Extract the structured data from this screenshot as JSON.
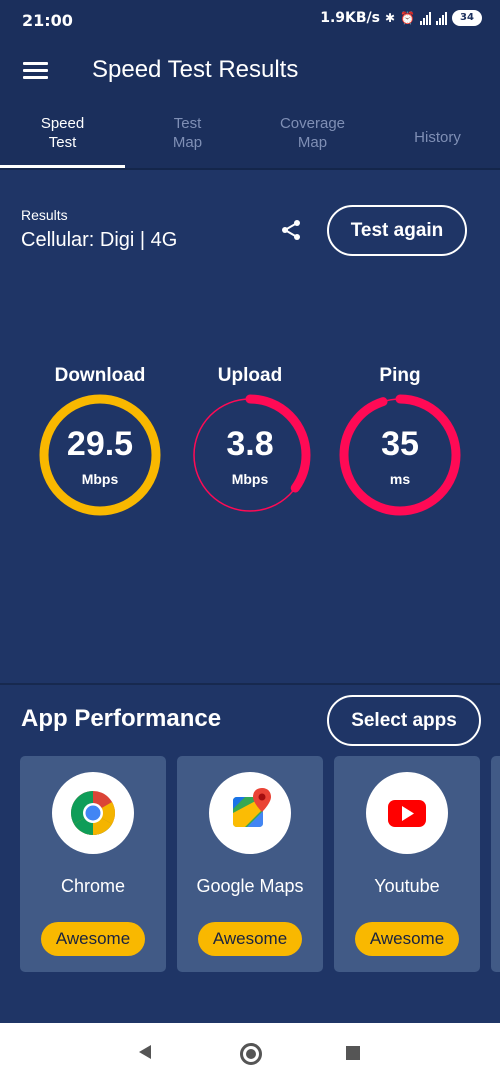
{
  "status_bar": {
    "time": "21:00",
    "net_speed": "1.9KB/s",
    "battery": "34"
  },
  "app_bar": {
    "title": "Speed Test Results"
  },
  "tabs": [
    {
      "label_line1": "Speed",
      "label_line2": "Test"
    },
    {
      "label_line1": "Test",
      "label_line2": "Map"
    },
    {
      "label_line1": "Coverage",
      "label_line2": "Map"
    },
    {
      "label_line1": "History",
      "label_line2": ""
    }
  ],
  "results": {
    "label": "Results",
    "value": "Cellular: Digi | 4G",
    "test_again_label": "Test again"
  },
  "gauges": [
    {
      "title": "Download",
      "value": "29.5",
      "unit": "Mbps",
      "fill": 1.0,
      "color": "#f9b800"
    },
    {
      "title": "Upload",
      "value": "3.8",
      "unit": "Mbps",
      "fill": 0.35,
      "color": "#ff0a55"
    },
    {
      "title": "Ping",
      "value": "35",
      "unit": "ms",
      "fill": 0.95,
      "color": "#ff0a55"
    }
  ],
  "app_performance": {
    "title": "App Performance",
    "select_apps_label": "Select apps",
    "apps": [
      {
        "name": "Chrome",
        "rating": "Awesome",
        "icon": "chrome-icon"
      },
      {
        "name": "Google Maps",
        "rating": "Awesome",
        "icon": "google-maps-icon"
      },
      {
        "name": "Youtube",
        "rating": "Awesome",
        "icon": "youtube-icon"
      }
    ]
  },
  "colors": {
    "background": "#1f3566",
    "accent_yellow": "#f9b800",
    "accent_red": "#ff0a55",
    "card": "#415a86"
  }
}
